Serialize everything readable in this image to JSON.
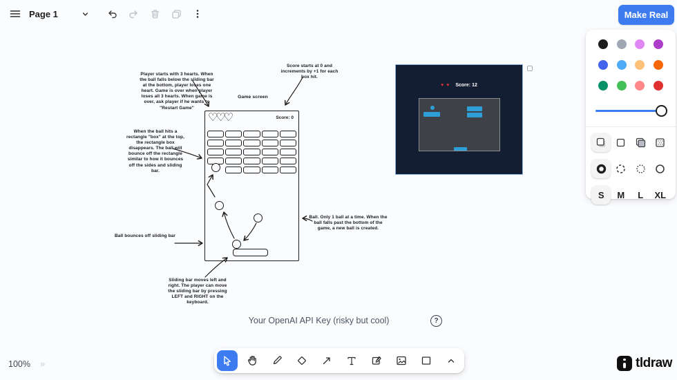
{
  "app": {
    "page_name": "Page 1",
    "zoom_level": "100%",
    "logo_text": "tldraw"
  },
  "header": {
    "make_real_label": "Make Real"
  },
  "style_panel": {
    "colors": [
      {
        "name": "black",
        "hex": "#1d1d1d"
      },
      {
        "name": "grey",
        "hex": "#9fa8b2"
      },
      {
        "name": "light-violet",
        "hex": "#e085f4"
      },
      {
        "name": "violet",
        "hex": "#ae3ec9"
      },
      {
        "name": "blue",
        "hex": "#4263eb"
      },
      {
        "name": "light-blue",
        "hex": "#4dabf7"
      },
      {
        "name": "yellow",
        "hex": "#ffc078"
      },
      {
        "name": "orange",
        "hex": "#f76707"
      },
      {
        "name": "green",
        "hex": "#099268"
      },
      {
        "name": "light-green",
        "hex": "#40c057"
      },
      {
        "name": "light-red",
        "hex": "#ff8787"
      },
      {
        "name": "red",
        "hex": "#e03131"
      }
    ],
    "opacity_percent": 100,
    "fill_options": [
      "semi",
      "none",
      "solid",
      "pattern"
    ],
    "selected_fill": "semi",
    "dash_options": [
      "draw",
      "dashed",
      "dotted",
      "solid"
    ],
    "selected_dash": "draw",
    "sizes": [
      "S",
      "M",
      "L",
      "XL"
    ],
    "selected_size": "S",
    "accent": "#3d7cf0"
  },
  "sketch": {
    "annotations": {
      "player_note": "Player starts with 3 hearts. When\nthe ball falls below the sliding bar\nat the bottom, player loses one\nheart. Game is over when player\nloses all 3 hearts. When game is\nover, ask player if he wants to\n\"Restart Game\"",
      "score_note": "Score starts at 0 and\nincrements by +1 for each\nbox hit.",
      "game_screen_label": "Game screen",
      "brick_note": "When the ball hits a\nrectangle \"box\" at the top,\nthe rectangle box\ndisappears. The ball will\nbounce off the rectangle\nsimilar to how it bounces\noff the sides and sliding\nbar.",
      "bounce_note": "Ball bounces off sliding bar",
      "ball_note": "Ball. Only 1 ball at a time. When the\nball falls past the bottom of the\ngame, a new ball is created.",
      "sliding_note": "Sliding bar moves left and\nright. The player can move\nthe sliding bar by pressing\nLEFT and RIGHT on the\nkeyboard."
    },
    "hearts": "♡♡♡",
    "score_label": "Score: 0",
    "bricks": {
      "rows": 5,
      "cols": 5,
      "missing": [
        [
          4,
          0
        ]
      ]
    }
  },
  "preview": {
    "hearts": "♥ ♥",
    "score_label": "Score: 12",
    "background": "#141e33",
    "element_color": "#2e9fd6",
    "selected": true
  },
  "footer": {
    "api_key_placeholder": "Your OpenAI API Key (risky but cool)",
    "help_label": "?"
  },
  "toolbar": {
    "tools": [
      "select",
      "hand",
      "draw",
      "eraser",
      "arrow",
      "text",
      "note",
      "asset",
      "rectangle",
      "more"
    ],
    "selected_tool": "select"
  }
}
